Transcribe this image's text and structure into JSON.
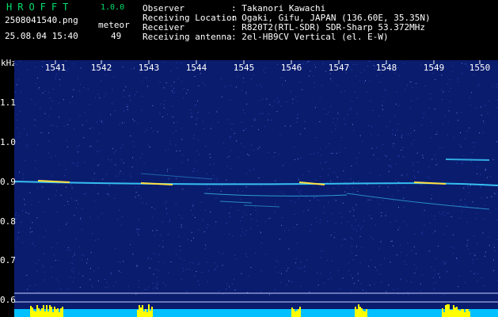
{
  "header": {
    "logo": "HROFFT",
    "version": "1.0.0",
    "filename": "2508041540.png",
    "datetime": "25.08.04 15:40",
    "meteor_label": "meteor",
    "meteor_count": "49",
    "fields": [
      {
        "label": "Observer",
        "value": ": Takanori Kawachi"
      },
      {
        "label": "Receiving Location",
        "value": ": Ogaki, Gifu, JAPAN (136.60E, 35.35N)"
      },
      {
        "label": "Receiver",
        "value": ": R820T2(RTL-SDR) SDR-Sharp 53.372MHz"
      },
      {
        "label": "Receiving antenna",
        "value": ": 2el-HB9CV Vertical (el. E-W)"
      }
    ]
  },
  "axes": {
    "y_unit": "kHz",
    "y_ticks": [
      "1.1",
      "1.0",
      "0.9",
      "0.8",
      "0.7",
      "0.6"
    ],
    "x_ticks": [
      "1541",
      "1542",
      "1543",
      "1544",
      "1545",
      "1546",
      "1547",
      "1548",
      "1549",
      "1550"
    ]
  },
  "colors": {
    "background": "#000000",
    "spectrum": "#0a1c6e",
    "trace": "#3ad0ff",
    "hot": "#ffe040",
    "signal_bars": "#ffff00",
    "noise_floor": "#00c0ff",
    "logo": "#00e06a"
  }
}
